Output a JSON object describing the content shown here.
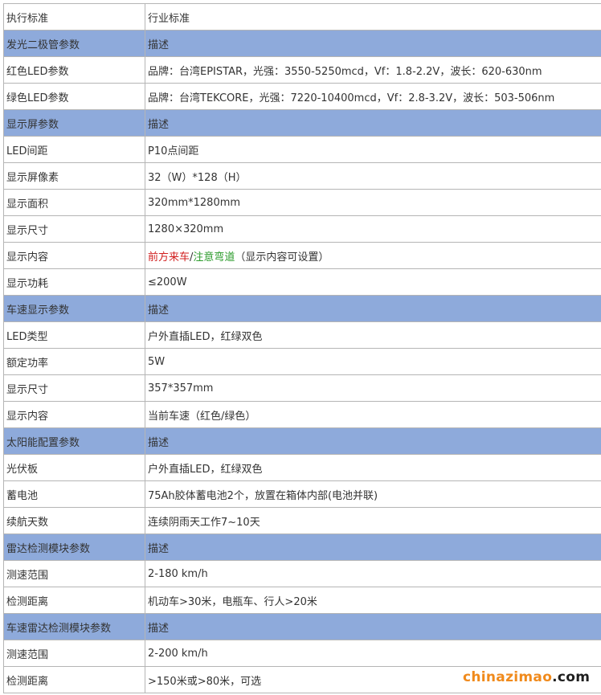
{
  "rows": [
    {
      "type": "normal",
      "name": "执行标准",
      "value": "行业标准"
    },
    {
      "type": "section",
      "name": "发光二极管参数",
      "value": "描述"
    },
    {
      "type": "normal",
      "name": "红色LED参数",
      "value": "品牌：台湾EPISTAR，光强：3550-5250mcd，Vf：1.8-2.2V，波长：620-630nm"
    },
    {
      "type": "normal",
      "name": "绿色LED参数",
      "value": "品牌：台湾TEKCORE，光强：7220-10400mcd，Vf：2.8-3.2V，波长：503-506nm"
    },
    {
      "type": "section",
      "name": "显示屏参数",
      "value": "描述"
    },
    {
      "type": "normal",
      "name": "LED间距",
      "value": "P10点间距"
    },
    {
      "type": "normal",
      "name": "显示屏像素",
      "value": "32（W）*128（H）"
    },
    {
      "type": "normal",
      "name": "显示面积",
      "value": "320mm*1280mm"
    },
    {
      "type": "normal",
      "name": "显示尺寸",
      "value": "1280×320mm"
    },
    {
      "type": "colored",
      "name": "显示内容",
      "value_red": "前方来车",
      "value_sep": "/",
      "value_green": "注意弯道",
      "value_rest": "（显示内容可设置）"
    },
    {
      "type": "normal",
      "name": "显示功耗",
      "value": "≤200W"
    },
    {
      "type": "section",
      "name": "车速显示参数",
      "value": "描述"
    },
    {
      "type": "normal",
      "name": "LED类型",
      "value": "户外直插LED，红绿双色"
    },
    {
      "type": "normal",
      "name": "额定功率",
      "value": "5W"
    },
    {
      "type": "normal",
      "name": "显示尺寸",
      "value": "357*357mm"
    },
    {
      "type": "normal",
      "name": "显示内容",
      "value": "当前车速（红色/绿色）"
    },
    {
      "type": "section",
      "name": "太阳能配置参数",
      "value": "描述"
    },
    {
      "type": "normal",
      "name": "光伏板",
      "value": "户外直插LED，红绿双色"
    },
    {
      "type": "normal",
      "name": "蓄电池",
      "value": "75Ah胶体蓄电池2个，放置在箱体内部(电池并联)"
    },
    {
      "type": "normal",
      "name": "续航天数",
      "value": "连续阴雨天工作7~10天"
    },
    {
      "type": "section",
      "name": "雷达检测模块参数",
      "value": "描述"
    },
    {
      "type": "normal",
      "name": "测速范围",
      "value": "2-180 km/h"
    },
    {
      "type": "normal",
      "name": "检测距离",
      "value": "机动车>30米，电瓶车、行人>20米"
    },
    {
      "type": "section",
      "name": "车速雷达检测模块参数",
      "value": "描述"
    },
    {
      "type": "normal",
      "name": "测速范围",
      "value": "2-200 km/h"
    },
    {
      "type": "normal",
      "name": "检测距离",
      "value": ">150米或>80米，可选"
    }
  ],
  "watermark": {
    "main": "chinazimao",
    "tld": ".com"
  },
  "colors": {
    "section_bg": "#8eaadb",
    "border": "#b5b5b5",
    "red_text": "#d11f1f",
    "green_text": "#2b9b2b",
    "watermark_orange": "#f08a1c"
  }
}
